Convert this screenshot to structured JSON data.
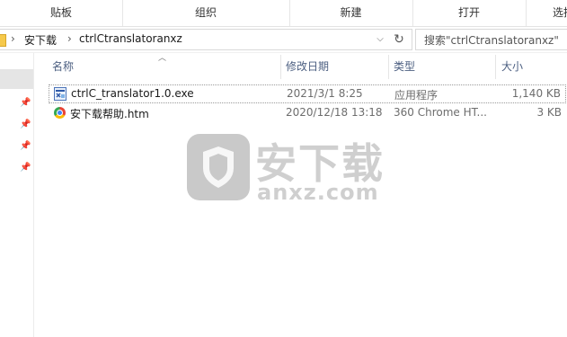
{
  "ribbon": {
    "groups": [
      "贴板",
      "组织",
      "新建",
      "打开",
      "选择"
    ]
  },
  "address": {
    "crumbs": [
      "安下载",
      "ctrlCtranslatoranxz"
    ],
    "search_placeholder": "搜索\"ctrlCtranslatoranxz\""
  },
  "columns": {
    "name": "名称",
    "modified": "修改日期",
    "type": "类型",
    "size": "大小"
  },
  "files": [
    {
      "name": "ctrlC_translator1.0.exe",
      "modified": "2021/3/1 8:25",
      "type": "应用程序",
      "size": "1,140 KB",
      "icon": "exe-icon"
    },
    {
      "name": "安下载帮助.htm",
      "modified": "2020/12/18 13:18",
      "type": "360 Chrome HT...",
      "size": "3 KB",
      "icon": "chrome-html-icon"
    }
  ],
  "watermark": {
    "big": "安下载",
    "small": "anxz.com"
  }
}
